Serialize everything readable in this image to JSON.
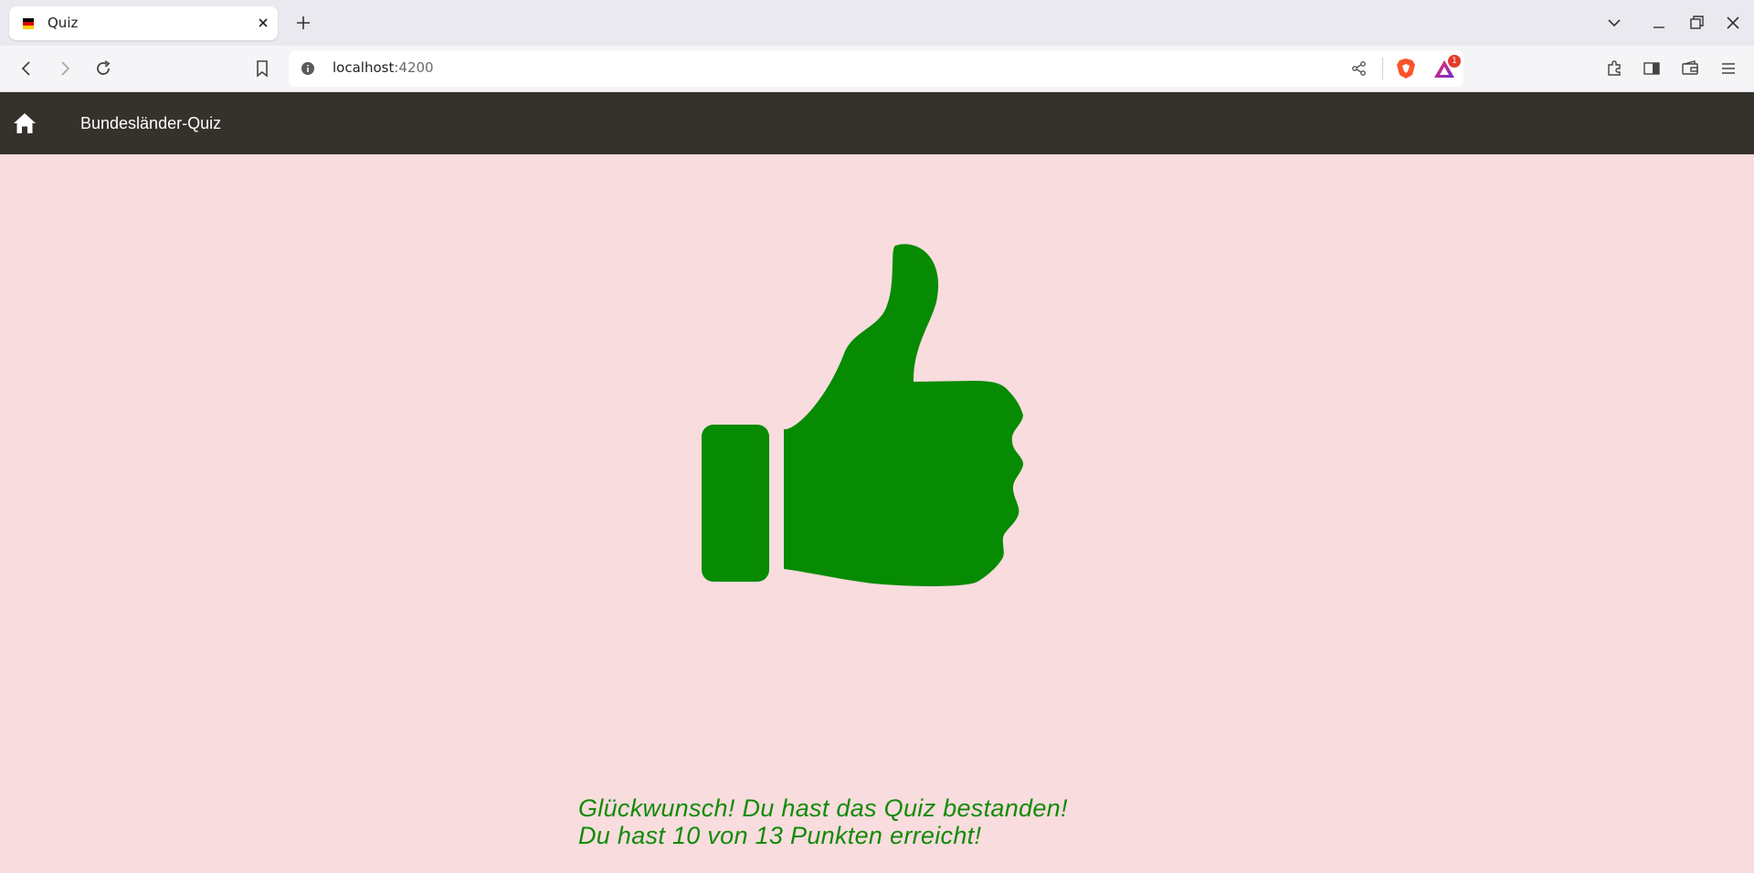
{
  "browser": {
    "tab": {
      "title": "Quiz",
      "favicon": "german-flag-icon"
    },
    "url": {
      "host": "localhost",
      "port": ":4200"
    },
    "rewards_badge": "1"
  },
  "navbar": {
    "title": "Bundesländer-Quiz",
    "home_icon": "home-icon",
    "background": "#35312b"
  },
  "result": {
    "icon": "thumbs-up-icon",
    "color": "#118b06",
    "line1": "Glückwunsch! Du hast das Quiz bestanden!",
    "line2": "Du hast 10 von 13 Punkten erreicht!"
  },
  "page": {
    "background": "#f9dcde"
  }
}
